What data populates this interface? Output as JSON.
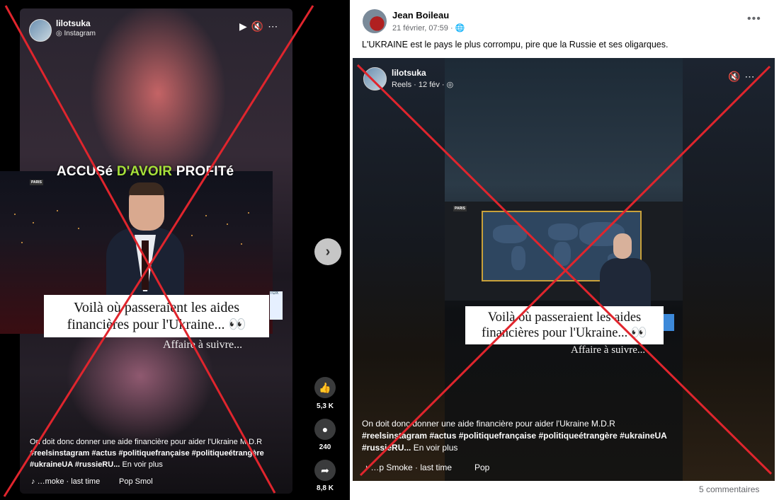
{
  "left_post": {
    "username": "lilotsuka",
    "source": "Instagram",
    "headline": {
      "part1": "ACCUSé ",
      "part2": "D'AVOIR",
      "part3": " PROFITé"
    },
    "studio_tag": "PARIS",
    "caption_line1": "Voilà où passeraient les aides",
    "caption_line2": "financières pour l'Ukraine... 👀",
    "caption_sub": "Affaire à suivre...",
    "side_label": "TOX",
    "description": "On doit donc donner une aide financière pour aider l'Ukraine M.D.R",
    "hashtags_line": "#reelsinstagram #actus #politiquefrançaise #politiqueétrangère",
    "hashtags_line2": "#ukraineUA #russieRU...",
    "see_more": "En voir plus",
    "music_left": "…moke · last time",
    "music_right": "Pop Smol",
    "likes": "5,3 K",
    "comments": "240",
    "shares": "8,8 K",
    "icons": [
      "play-icon",
      "mute-icon",
      "more-icon",
      "like-icon",
      "comment-icon",
      "share-icon",
      "chevron-right-icon"
    ]
  },
  "right_post": {
    "author": "Jean Boileau",
    "date": "21 février, 07:59 · ",
    "globe": "🌐",
    "text": "L'UKRAINE est le pays le plus corrompu, pire que la Russie et ses oligarques.",
    "embed_username": "lilotsuka",
    "embed_source": "Reels · 12 fév · ",
    "studio_tag": "PARIS",
    "caption_line1": "Voilà où passeraient les aides",
    "caption_line2": "financières pour l'Ukraine... 👀",
    "caption_sub": "Affaire à suivre...",
    "description": "On doit donc donner une aide financière pour aider l'Ukraine M.D.R",
    "hashtags_line": "#reelsinstagram #actus #politiquefrançaise #politiqueétrangère #ukraineUA",
    "hashtags_line2": "#russieRU...",
    "see_more": "En voir plus",
    "music_left": "…p Smoke · last time",
    "music_right": "Pop",
    "comment_count": "5 commentaires"
  },
  "colors": {
    "cross": "#e0252d",
    "headline_green": "#a6e03a",
    "fb_text": "#050505",
    "fb_muted": "#65676b"
  }
}
